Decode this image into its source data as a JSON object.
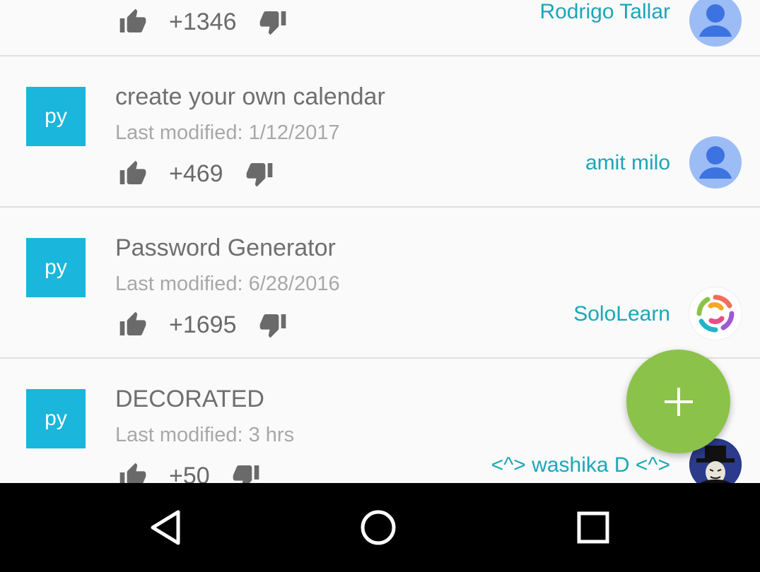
{
  "items": [
    {
      "badge": "",
      "title": "",
      "modified": "",
      "votes": "+1346",
      "author": "Rodrigo Tallar",
      "avatar_icon": "default-user-avatar-icon"
    },
    {
      "badge": "py",
      "title": "create your own calendar",
      "modified": "Last modified: 1/12/2017",
      "votes": "+469",
      "author": "amit milo",
      "avatar_icon": "default-user-avatar-icon"
    },
    {
      "badge": "py",
      "title": "Password Generator",
      "modified": "Last modified: 6/28/2016",
      "votes": "+1695",
      "author": "SoloLearn",
      "avatar_icon": "sololearn-logo-icon"
    },
    {
      "badge": "py",
      "title": "DECORATED",
      "modified": "Last modified: 3 hrs",
      "votes": "+50",
      "author": "<^> washika D <^>",
      "avatar_icon": "hacker-avatar-icon"
    }
  ],
  "fab": {
    "icon": "plus-icon",
    "color": "#8bc34a"
  },
  "colors": {
    "badge": "#1ab6db",
    "author": "#19a7b8",
    "background": "#fafafa"
  },
  "navbar": {
    "back_icon": "back-triangle-icon",
    "home_icon": "home-circle-icon",
    "recents_icon": "recents-square-icon"
  }
}
